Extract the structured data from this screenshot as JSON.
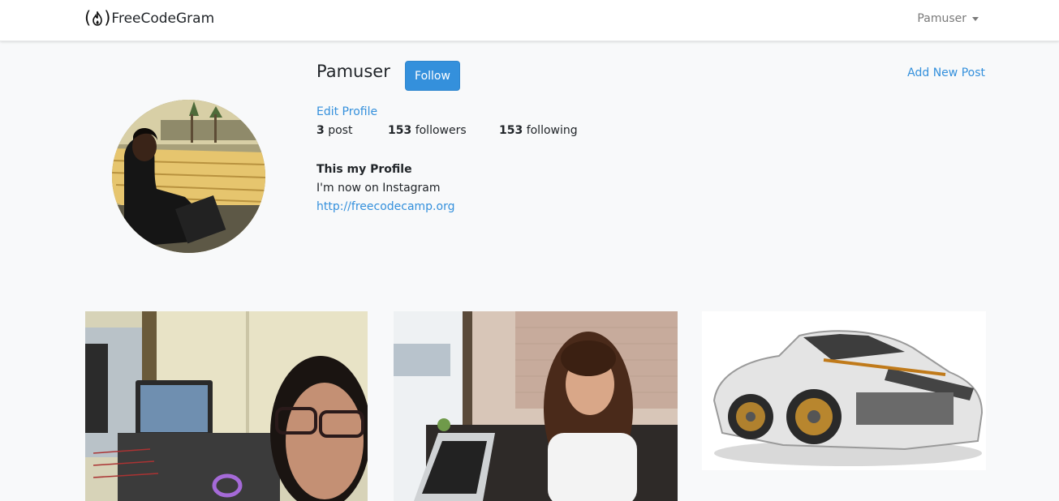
{
  "navbar": {
    "brand_name": "FreeCodeGram",
    "logo_open": "(",
    "logo_close": ")",
    "user_menu_label": "Pamuser"
  },
  "profile": {
    "username": "Pamuser",
    "follow_label": "Follow",
    "add_post_label": "Add New Post",
    "edit_profile_label": "Edit Profile",
    "stats": {
      "posts_count": "3",
      "posts_label": "post",
      "followers_count": "153",
      "followers_label": "followers",
      "following_count": "153",
      "following_label": "following"
    },
    "bio": {
      "title": "This my Profile",
      "description": "I'm now on Instagram",
      "url": "http://freecodecamp.org"
    }
  },
  "posts": [
    {
      "image": "selfie-with-laptops"
    },
    {
      "image": "woman-at-cafe-with-laptop"
    },
    {
      "image": "silver-sports-car"
    }
  ],
  "colors": {
    "accent": "#3490dc",
    "background": "#f8f9fa",
    "navbar": "#ffffff"
  }
}
